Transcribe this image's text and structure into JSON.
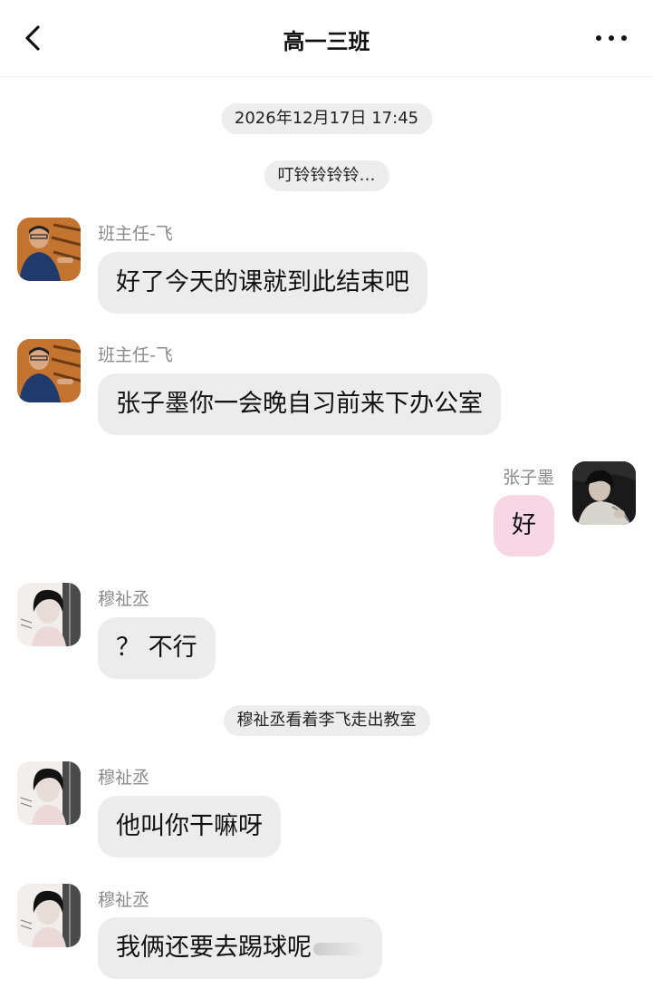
{
  "header": {
    "title": "高一三班",
    "back_icon": "chevron-left-icon",
    "more_icon": "more-horizontal-icon"
  },
  "chat": {
    "timestamp": "2026年12月17日 17:45",
    "system_notes": [
      "叮铃铃铃铃…",
      "穆祉丞看着李飞走出教室"
    ],
    "messages": [
      {
        "sender": "班主任-飞",
        "text": "好了今天的课就到此结束吧",
        "side": "left"
      },
      {
        "sender": "班主任-飞",
        "text": "张子墨你一会晚自习前来下办公室",
        "side": "left"
      },
      {
        "sender": "张子墨",
        "text": "好",
        "side": "right"
      },
      {
        "sender": "穆祉丞",
        "text": "？ 不行",
        "side": "left"
      },
      {
        "sender": "穆祉丞",
        "text": "他叫你干嘛呀",
        "side": "left"
      },
      {
        "sender": "穆祉丞",
        "text": "我俩还要去踢球呢",
        "side": "left"
      }
    ]
  },
  "colors": {
    "bubble_other": "#ececec",
    "bubble_self": "#f8d7e4",
    "pill": "#ededed",
    "sender_name": "#8a8a8a"
  }
}
